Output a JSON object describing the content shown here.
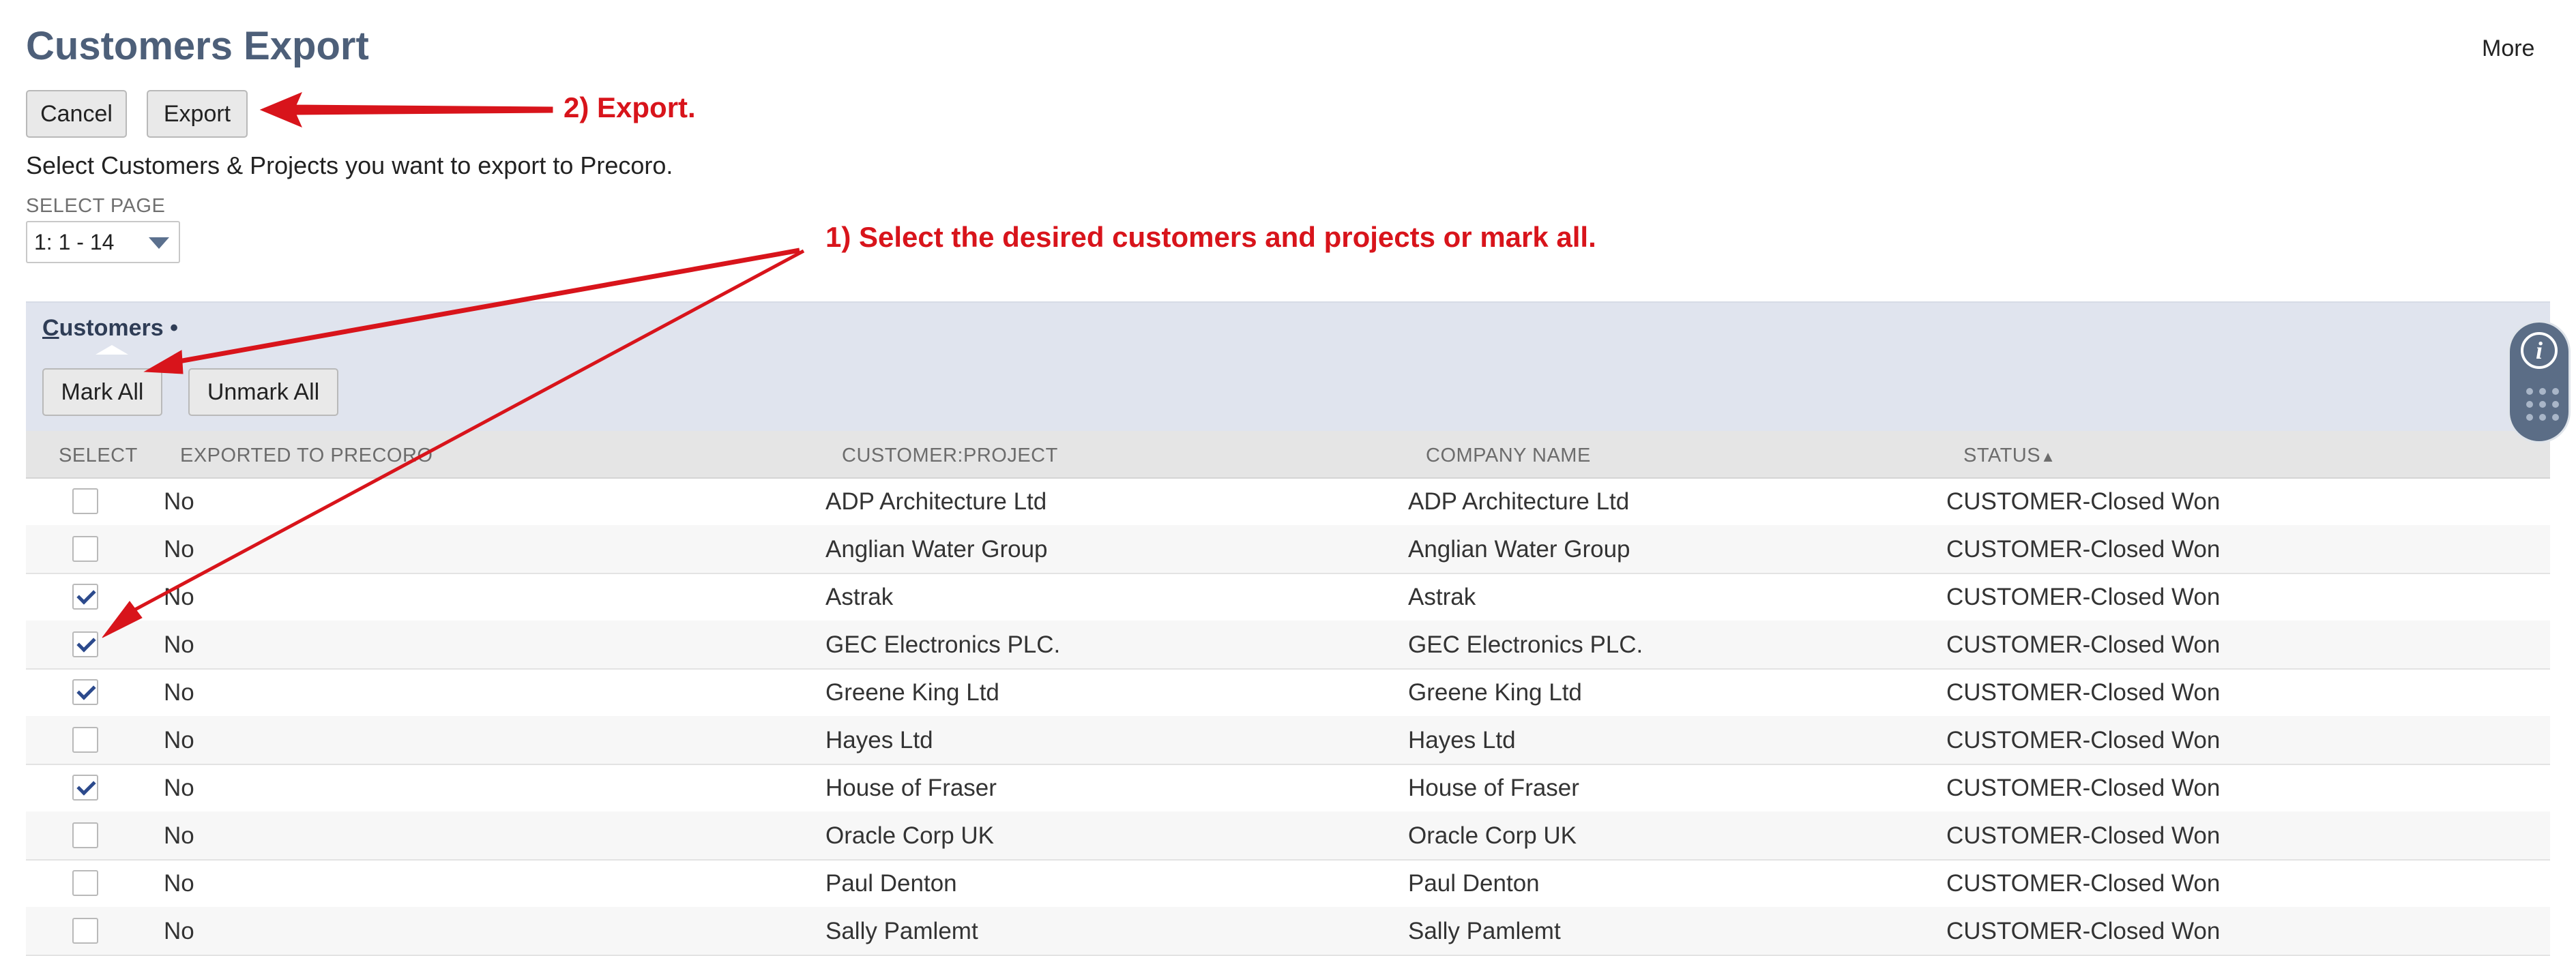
{
  "page": {
    "title": "Customers Export",
    "more_label": "More",
    "instructions": "Select Customers & Projects you want to export to Precoro."
  },
  "toolbar": {
    "cancel_label": "Cancel",
    "export_label": "Export"
  },
  "select_page": {
    "label": "SELECT PAGE",
    "value": "1: 1 - 14"
  },
  "section": {
    "tab_first_letter": "C",
    "tab_rest": "ustomers",
    "tab_marker": "•",
    "mark_all_label": "Mark All",
    "unmark_all_label": "Unmark All"
  },
  "table": {
    "columns": [
      "SELECT",
      "EXPORTED TO PRECORO",
      "CUSTOMER:PROJECT",
      "COMPANY NAME",
      "STATUS"
    ],
    "sort_indicator": "▲",
    "rows": [
      {
        "checked": false,
        "exported": "No",
        "customer": "ADP Architecture Ltd",
        "company": "ADP Architecture Ltd",
        "status": "CUSTOMER-Closed Won"
      },
      {
        "checked": false,
        "exported": "No",
        "customer": "Anglian Water Group",
        "company": "Anglian Water Group",
        "status": "CUSTOMER-Closed Won"
      },
      {
        "checked": true,
        "exported": "No",
        "customer": "Astrak",
        "company": "Astrak",
        "status": "CUSTOMER-Closed Won"
      },
      {
        "checked": true,
        "exported": "No",
        "customer": "GEC Electronics PLC.",
        "company": "GEC Electronics PLC.",
        "status": "CUSTOMER-Closed Won"
      },
      {
        "checked": true,
        "exported": "No",
        "customer": "Greene King Ltd",
        "company": "Greene King Ltd",
        "status": "CUSTOMER-Closed Won"
      },
      {
        "checked": false,
        "exported": "No",
        "customer": "Hayes Ltd",
        "company": "Hayes Ltd",
        "status": "CUSTOMER-Closed Won"
      },
      {
        "checked": true,
        "exported": "No",
        "customer": "House of Fraser",
        "company": "House of Fraser",
        "status": "CUSTOMER-Closed Won"
      },
      {
        "checked": false,
        "exported": "No",
        "customer": "Oracle Corp UK",
        "company": "Oracle Corp UK",
        "status": "CUSTOMER-Closed Won"
      },
      {
        "checked": false,
        "exported": "No",
        "customer": "Paul Denton",
        "company": "Paul Denton",
        "status": "CUSTOMER-Closed Won"
      },
      {
        "checked": false,
        "exported": "No",
        "customer": "Sally Pamlemt",
        "company": "Sally Pamlemt",
        "status": "CUSTOMER-Closed Won"
      }
    ]
  },
  "annotations": {
    "step_export": "2) Export.",
    "step_select": "1) Select the desired customers and projects or mark all."
  },
  "icons": {
    "info": "info-icon",
    "dots": "grid-dots-icon"
  },
  "colors": {
    "title": "#4d5f79",
    "annotation": "#d8141b",
    "section_bg": "#e0e4ee",
    "check": "#2c4a8c"
  }
}
